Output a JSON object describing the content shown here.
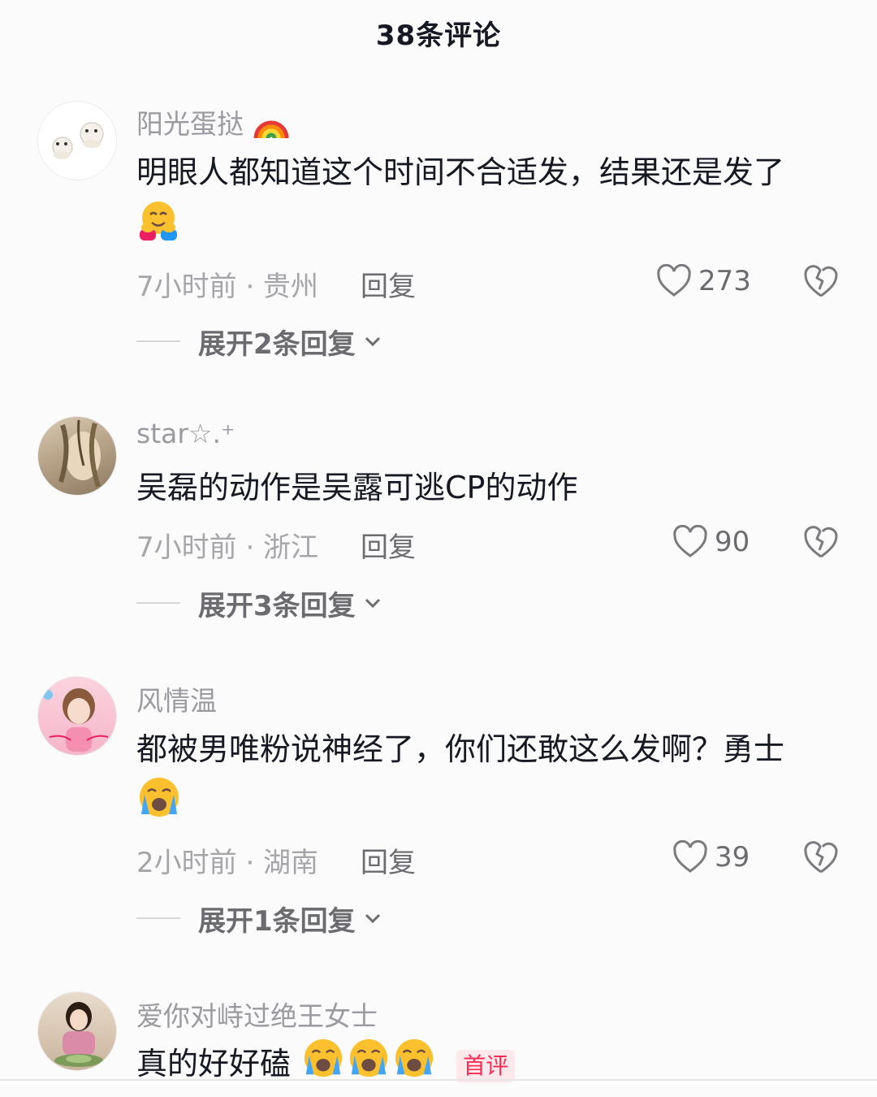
{
  "header": {
    "title": "38条评论"
  },
  "comments": [
    {
      "username": "阳光蛋挞",
      "text": "明眼人都知道这个时间不合适发，结果还是发了",
      "time": "7小时前 · 贵州",
      "reply": "回复",
      "likes": "273",
      "expand": "展开2条回复"
    },
    {
      "username": "star☆.⁺",
      "text": "吴磊的动作是吴露可逃CP的动作",
      "time": "7小时前 · 浙江",
      "reply": "回复",
      "likes": "90",
      "expand": "展开3条回复"
    },
    {
      "username": "风情温",
      "text": "都被男唯粉说神经了，你们还敢这么发啊？勇士",
      "time": "2小时前 · 湖南",
      "reply": "回复",
      "likes": "39",
      "expand": "展开1条回复"
    },
    {
      "username": "爱你对峙过绝王女士",
      "text": "真的好好磕",
      "badge": "首评"
    }
  ],
  "icons": {
    "like": "heart-outline-icon",
    "dislike": "broken-heart-icon",
    "expand": "chevron-down-icon",
    "emoji_hug": "hugging-face-emoji",
    "emoji_cry": "loudly-crying-face-emoji",
    "emoji_rainbow": "rainbow-emoji"
  },
  "colors": {
    "badge": "#fe2c55",
    "text": "#161823",
    "secondary": "#a5a5aa"
  }
}
